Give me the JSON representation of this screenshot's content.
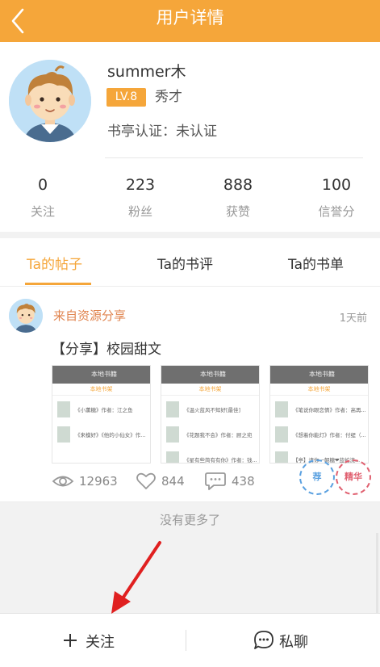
{
  "header": {
    "title": "用户详情",
    "back_icon": "chevron-left-icon"
  },
  "user": {
    "name": "summer木",
    "level": "LV.8",
    "rank": "秀才",
    "certification": "书亭认证：未认证"
  },
  "stats": [
    {
      "value": "0",
      "label": "关注"
    },
    {
      "value": "223",
      "label": "粉丝"
    },
    {
      "value": "888",
      "label": "获赞"
    },
    {
      "value": "100",
      "label": "信誉分"
    }
  ],
  "tabs": [
    {
      "label": "Ta的帖子",
      "active": true
    },
    {
      "label": "Ta的书评",
      "active": false
    },
    {
      "label": "Ta的书单",
      "active": false
    }
  ],
  "post": {
    "source": "来自资源分享",
    "time": "1天前",
    "title": "【分享】校园甜文",
    "thumbnails": [
      {
        "header": "本地书籍",
        "sub": "本地书架",
        "rows": [
          "《小薰糖》作者：江之鱼",
          "《来模好》《他的小仙女》作..."
        ]
      },
      {
        "header": "本地书籍",
        "sub": "本地书架",
        "rows": [
          "《温火蓝风不知好[最佳]",
          "《花题我不会》作者：顾之宛",
          "《星有些简有有你》作者：钱..."
        ]
      },
      {
        "header": "本地书籍",
        "sub": "本地书架",
        "rows": [
          "《笔说你眼恋情》作者：高再...",
          "《想着你能灯》作者：付缇（...",
          "【亭】请你一朝糖❤蓝蛇流..."
        ]
      }
    ],
    "views": "12963",
    "likes": "844",
    "comments": "438",
    "stamps": [
      "荐",
      "精华"
    ]
  },
  "footer_note": "没有更多了",
  "bottom": {
    "follow": "关注",
    "message": "私聊"
  },
  "colors": {
    "accent": "#f5a63a",
    "source": "#e0844f",
    "annotation_arrow": "#e02020"
  }
}
